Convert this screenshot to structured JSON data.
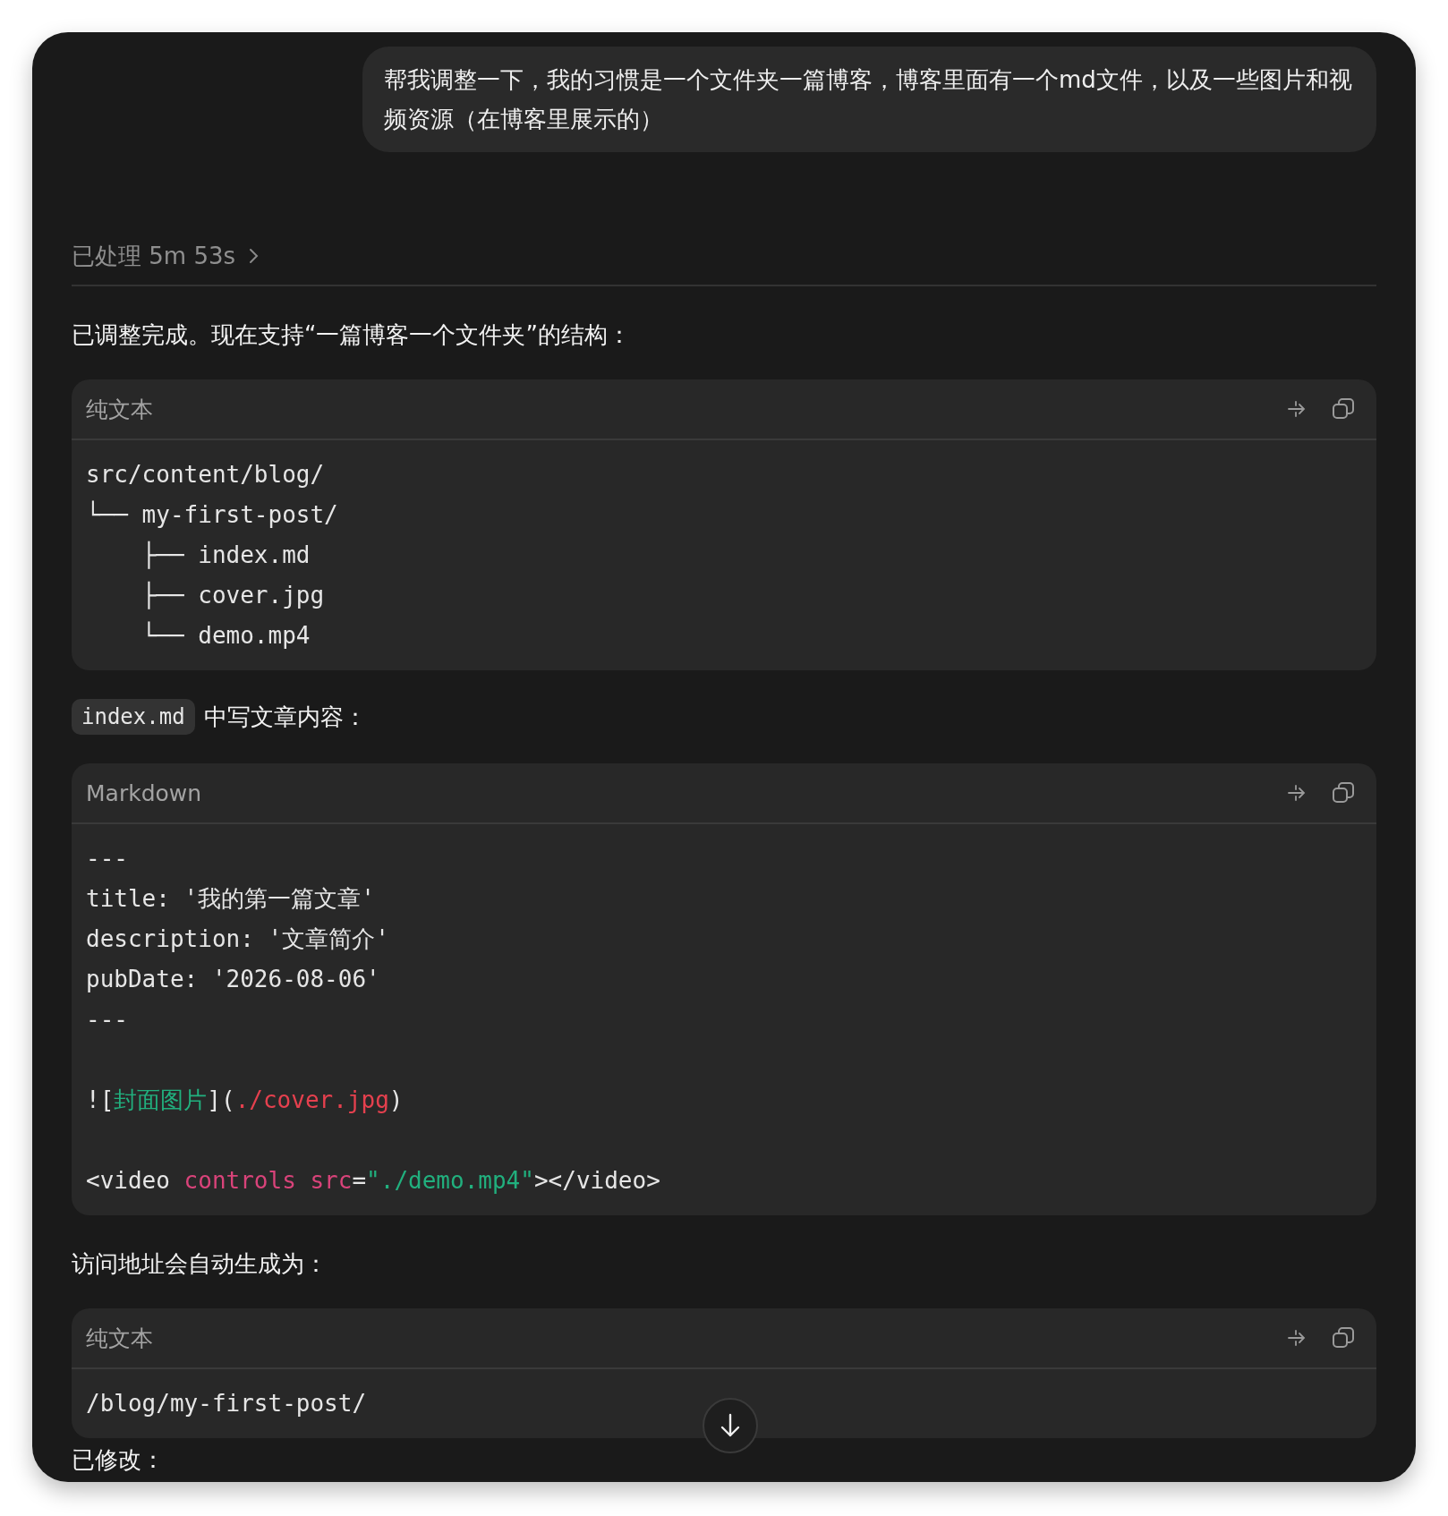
{
  "user_message": "帮我调整一下，我的习惯是一个文件夹一篇博客，博客里面有一个md文件，以及一些图片和视频资源（在博客里展示的）",
  "processed": {
    "label": "已处理 5m 53s",
    "expanded": false
  },
  "blocks": [
    {
      "kind": "paragraph",
      "text": "已调整完成。现在支持“一篇博客一个文件夹”的结构："
    },
    {
      "kind": "code",
      "language": "纯文本",
      "lines": [
        {
          "space_before": false,
          "tokens": [
            {
              "kind": "plain",
              "text": "src/content/blog/"
            }
          ]
        },
        {
          "space_before": false,
          "tokens": [
            {
              "kind": "plain",
              "text": "└── my-first-post/"
            }
          ]
        },
        {
          "space_before": false,
          "tokens": [
            {
              "kind": "plain",
              "text": "    ├── index.md"
            }
          ]
        },
        {
          "space_before": false,
          "tokens": [
            {
              "kind": "plain",
              "text": "    ├── cover.jpg"
            }
          ]
        },
        {
          "space_before": false,
          "tokens": [
            {
              "kind": "plain",
              "text": "    └── demo.mp4"
            }
          ]
        }
      ]
    },
    {
      "kind": "inline_code_paragraph",
      "code": "index.md",
      "text": "中写文章内容："
    },
    {
      "kind": "code",
      "language": "Markdown",
      "lines": [
        {
          "space_before": false,
          "tokens": [
            {
              "kind": "plain",
              "text": "---"
            }
          ]
        },
        {
          "space_before": false,
          "tokens": [
            {
              "kind": "plain",
              "text": "title: '我的第一篇文章'"
            }
          ]
        },
        {
          "space_before": false,
          "tokens": [
            {
              "kind": "plain",
              "text": "description: '文章简介'"
            }
          ]
        },
        {
          "space_before": false,
          "tokens": [
            {
              "kind": "plain",
              "text": "pubDate: '2026-08-06'"
            }
          ]
        },
        {
          "space_before": false,
          "tokens": [
            {
              "kind": "plain",
              "text": "---"
            }
          ]
        },
        {
          "space_before": true,
          "tokens": [
            {
              "kind": "plain",
              "text": "!["
            },
            {
              "kind": "string",
              "text": "封面图片"
            },
            {
              "kind": "plain",
              "text": "]("
            },
            {
              "kind": "link",
              "text": "./cover.jpg"
            },
            {
              "kind": "plain",
              "text": ")"
            }
          ]
        },
        {
          "space_before": true,
          "tokens": [
            {
              "kind": "plain",
              "text": "<video "
            },
            {
              "kind": "attribute",
              "text": "controls src"
            },
            {
              "kind": "plain",
              "text": "="
            },
            {
              "kind": "string",
              "text": "\"./demo.mp4\""
            },
            {
              "kind": "plain",
              "text": "></video>"
            }
          ]
        }
      ]
    },
    {
      "kind": "paragraph",
      "text": "访问地址会自动生成为："
    },
    {
      "kind": "code",
      "language": "纯文本",
      "lines": [
        {
          "space_before": false,
          "tokens": [
            {
              "kind": "plain",
              "text": "/blog/my-first-post/"
            }
          ]
        }
      ]
    },
    {
      "kind": "paragraph",
      "text": "已修改："
    }
  ]
}
